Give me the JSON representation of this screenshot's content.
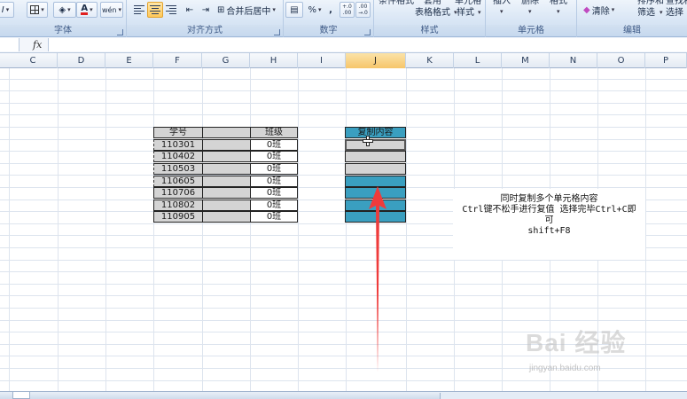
{
  "ribbon": {
    "groups": {
      "font": "字体",
      "alignment": "对齐方式",
      "number": "数字",
      "styles": "样式",
      "cells": "单元格",
      "editing": "编辑"
    },
    "merge_center": "合并后居中",
    "percent": "%",
    "comma": ",",
    "inc_decimal": "+.0 .00",
    "dec_decimal": ".00 →.0",
    "cond_format": "条件格式",
    "table_format_1": "套用",
    "table_format_2": "表格格式",
    "cell_styles_1": "单元格",
    "cell_styles_2": "样式",
    "insert": "插入",
    "delete": "删除",
    "format": "格式",
    "clear": "清除",
    "sort_1": "排序和",
    "sort_2": "筛选",
    "find_1": "查找和",
    "find_2": "选择",
    "phonetic": "wén"
  },
  "formula_bar": {
    "fx": "fx",
    "value": ""
  },
  "columns": [
    "C",
    "D",
    "E",
    "F",
    "G",
    "H",
    "I",
    "J",
    "K",
    "L",
    "M",
    "N",
    "O",
    "P"
  ],
  "selected_column": "J",
  "table_left": {
    "headers": [
      "学号",
      "",
      "班级"
    ],
    "rows": [
      [
        "110301",
        "",
        "0班"
      ],
      [
        "110402",
        "",
        "0班"
      ],
      [
        "110503",
        "",
        "0班"
      ],
      [
        "110605",
        "",
        "0班"
      ],
      [
        "110706",
        "",
        "0班"
      ],
      [
        "110802",
        "",
        "0班"
      ],
      [
        "110905",
        "",
        "0班"
      ]
    ]
  },
  "table_right": {
    "header": "复制内容"
  },
  "note": {
    "line1": "同时复制多个单元格内容",
    "line2": "Ctrl键不松手进行复值 选择完毕Ctrl+C即",
    "line3": "可",
    "line4": "shift+F8"
  },
  "watermark": {
    "main": "Bai 经验",
    "sub": "jingyan.baidu.com"
  },
  "colors": {
    "teal": "#3a9fc0",
    "gray": "#d4d4d4",
    "arrow": "#ef3b3b",
    "selected_col": "#f6c56a"
  }
}
